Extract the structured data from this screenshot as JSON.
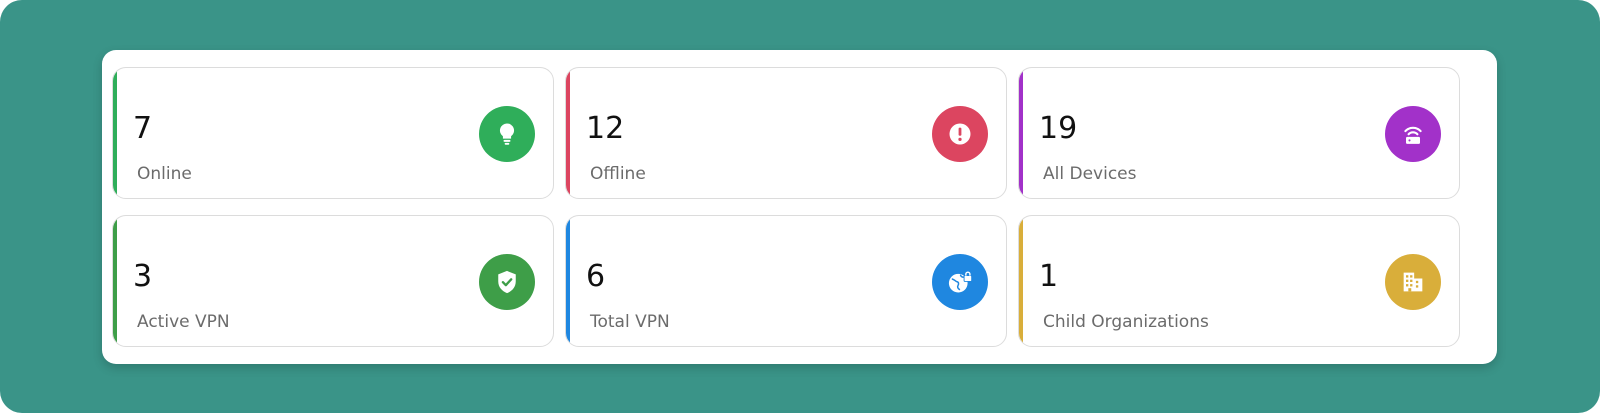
{
  "colors": {
    "background": "#3a9488",
    "panel": "#ffffff",
    "online": "#2fae5a",
    "offline": "#dc4560",
    "all_devices": "#a231c9",
    "active_vpn": "#3e9e48",
    "total_vpn": "#1f87e0",
    "child_orgs": "#d9ae3a"
  },
  "cards": [
    {
      "value": "7",
      "label": "Online",
      "icon": "lightbulb-icon"
    },
    {
      "value": "12",
      "label": "Offline",
      "icon": "alert-circle-icon"
    },
    {
      "value": "19",
      "label": "All Devices",
      "icon": "router-icon"
    },
    {
      "value": "3",
      "label": "Active VPN",
      "icon": "shield-check-icon"
    },
    {
      "value": "6",
      "label": "Total VPN",
      "icon": "globe-lock-icon"
    },
    {
      "value": "1",
      "label": "Child Organizations",
      "icon": "building-icon"
    }
  ]
}
